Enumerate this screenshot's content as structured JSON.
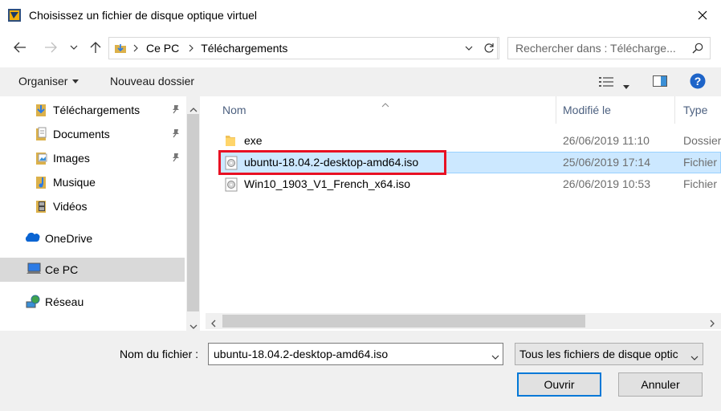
{
  "window": {
    "title": "Choisissez un fichier de disque optique virtuel"
  },
  "address": {
    "segments": [
      "Ce PC",
      "Téléchargements"
    ],
    "search_placeholder": "Rechercher dans : Télécharge..."
  },
  "toolbar": {
    "organize_label": "Organiser",
    "new_folder_label": "Nouveau dossier"
  },
  "sidebar": {
    "items": [
      {
        "label": "Téléchargements",
        "icon": "downloads-icon",
        "pinned": true
      },
      {
        "label": "Documents",
        "icon": "documents-icon",
        "pinned": true
      },
      {
        "label": "Images",
        "icon": "images-icon",
        "pinned": true
      },
      {
        "label": "Musique",
        "icon": "music-icon",
        "pinned": false
      },
      {
        "label": "Vidéos",
        "icon": "videos-icon",
        "pinned": false
      },
      {
        "label": "OneDrive",
        "icon": "onedrive-icon",
        "pinned": false
      },
      {
        "label": "Ce PC",
        "icon": "computer-icon",
        "pinned": false,
        "selected": true
      },
      {
        "label": "Réseau",
        "icon": "network-icon",
        "pinned": false
      }
    ]
  },
  "columns": {
    "name": "Nom",
    "modified": "Modifié le",
    "type": "Type"
  },
  "files": [
    {
      "name": "exe",
      "modified": "26/06/2019 11:10",
      "type": "Dossier",
      "icon": "folder-icon"
    },
    {
      "name": "ubuntu-18.04.2-desktop-amd64.iso",
      "modified": "25/06/2019 17:14",
      "type": "Fichier",
      "icon": "disc-image-icon",
      "selected": true,
      "highlighted": true
    },
    {
      "name": "Win10_1903_V1_French_x64.iso",
      "modified": "26/06/2019 10:53",
      "type": "Fichier",
      "icon": "disc-image-icon"
    }
  ],
  "footer": {
    "filename_label": "Nom du fichier :",
    "filename_value": "ubuntu-18.04.2-desktop-amd64.iso",
    "filter_value": "Tous les fichiers de disque optic",
    "open_label": "Ouvrir",
    "cancel_label": "Annuler"
  },
  "colors": {
    "accent": "#0078d7",
    "selection": "#cce8ff",
    "highlight_box": "#e81123",
    "column_header": "#4d6180",
    "toolbar_bg": "#f0f0f0"
  }
}
